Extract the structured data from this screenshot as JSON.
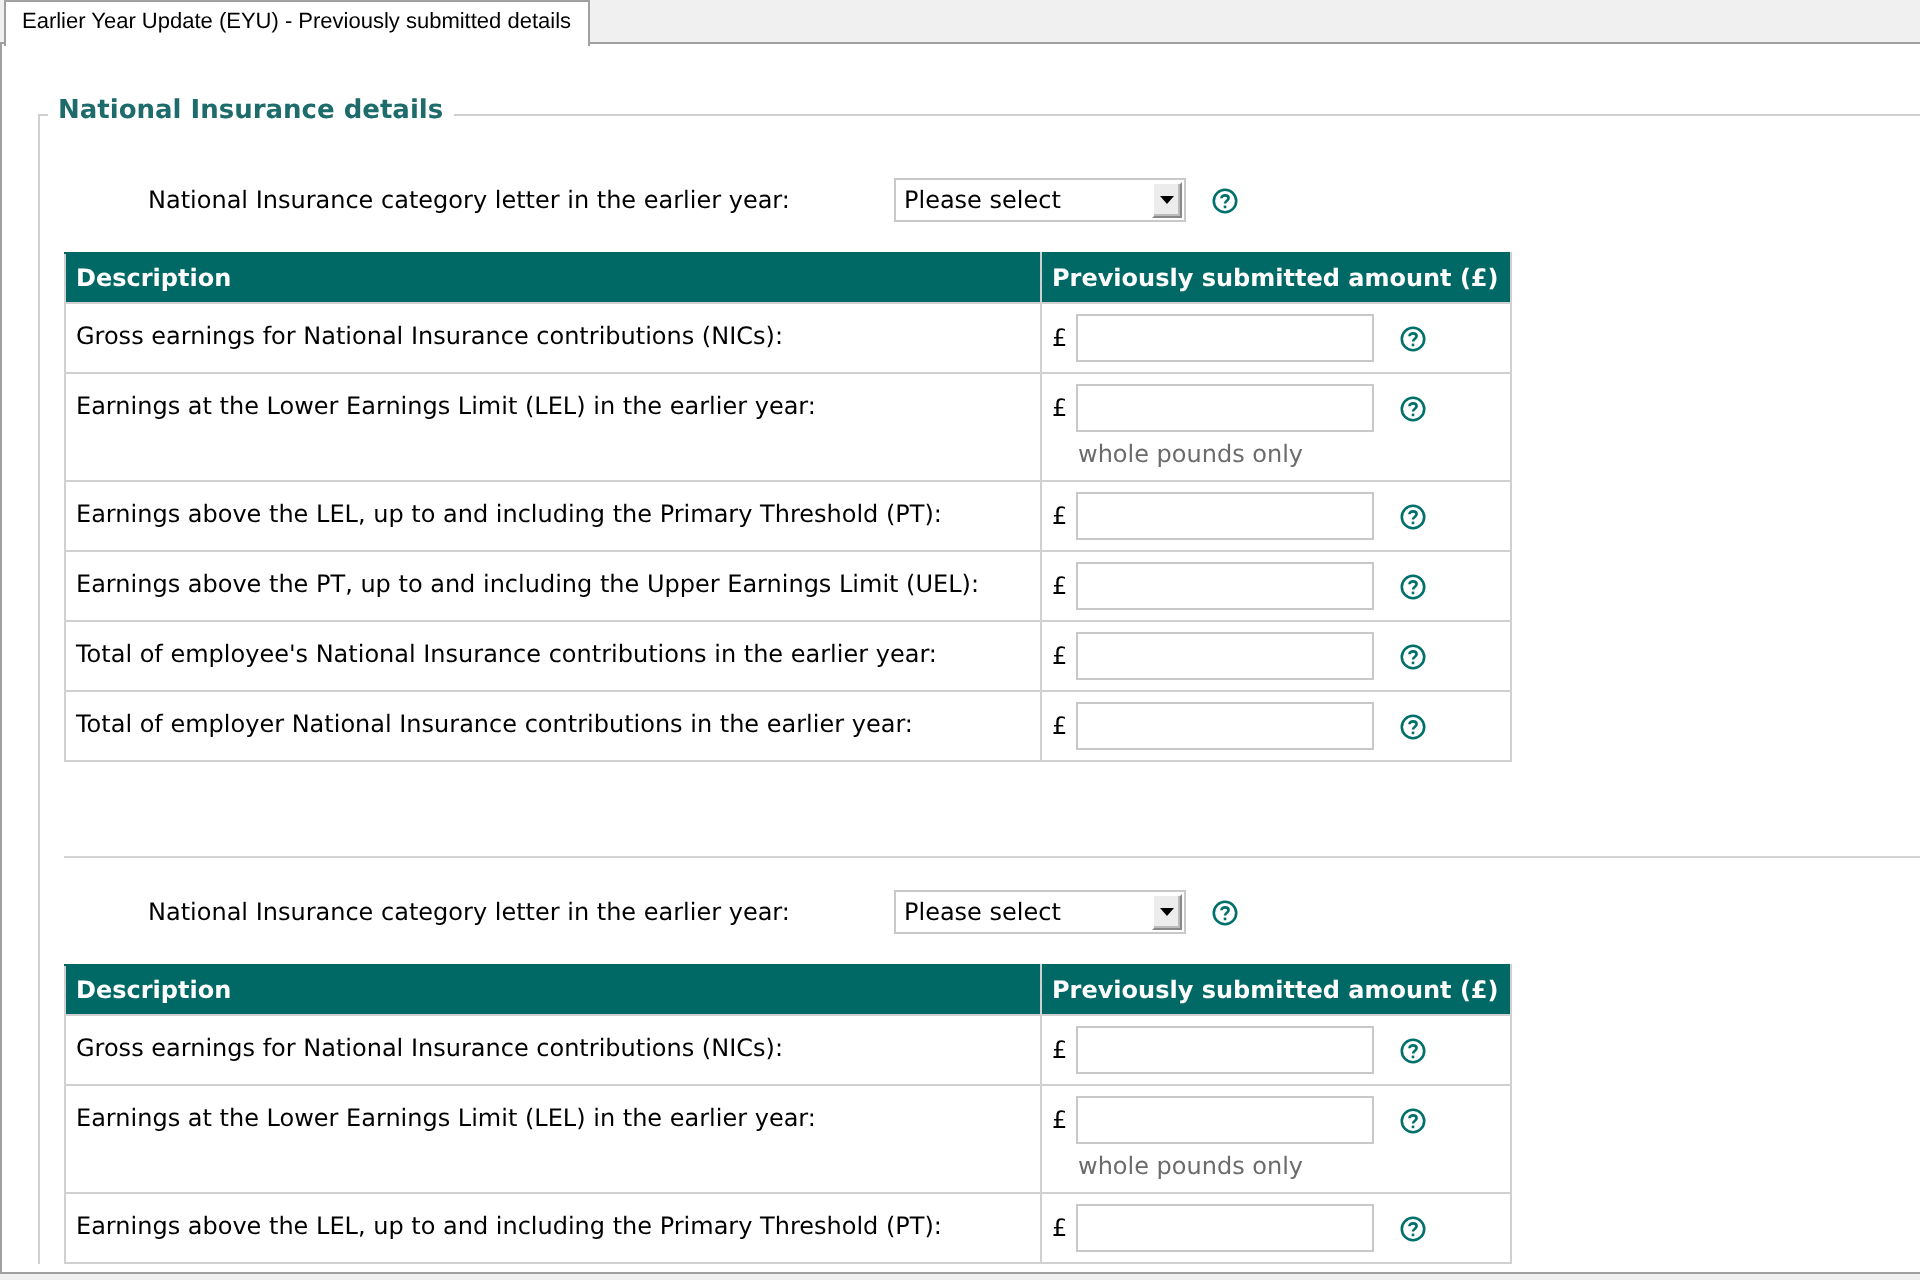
{
  "tabs": [
    {
      "label": "Earlier Year Update (EYU) - Previously submitted details",
      "selected": true
    }
  ],
  "fieldset": {
    "legend": "National Insurance details"
  },
  "sections": [
    {
      "category": {
        "label": "National Insurance category letter in the earlier year:",
        "value": "Please select"
      },
      "columns": [
        "Description",
        "Previously submitted amount (£)"
      ],
      "rows": [
        {
          "label": "Gross earnings for National Insurance contributions (NICs):",
          "currency": "£"
        },
        {
          "label": "Earnings at the Lower Earnings Limit (LEL) in the earlier year:",
          "currency": "£",
          "hint": "whole pounds only"
        },
        {
          "label": "Earnings above the LEL, up to and including the Primary Threshold (PT):",
          "currency": "£"
        },
        {
          "label": "Earnings above the PT, up to and including the Upper Earnings Limit (UEL):",
          "currency": "£"
        },
        {
          "label": "Total of employee's National Insurance contributions in the earlier year:",
          "currency": "£"
        },
        {
          "label": "Total of employer National Insurance contributions in the earlier year:",
          "currency": "£"
        }
      ]
    },
    {
      "category": {
        "label": "National Insurance category letter in the earlier year:",
        "value": "Please select"
      },
      "columns": [
        "Description",
        "Previously submitted amount (£)"
      ],
      "rows": [
        {
          "label": "Gross earnings for National Insurance contributions (NICs):",
          "currency": "£"
        },
        {
          "label": "Earnings at the Lower Earnings Limit (LEL) in the earlier year:",
          "currency": "£",
          "hint": "whole pounds only"
        },
        {
          "label": "Earnings above the LEL, up to and including the Primary Threshold (PT):",
          "currency": "£"
        }
      ]
    }
  ]
}
